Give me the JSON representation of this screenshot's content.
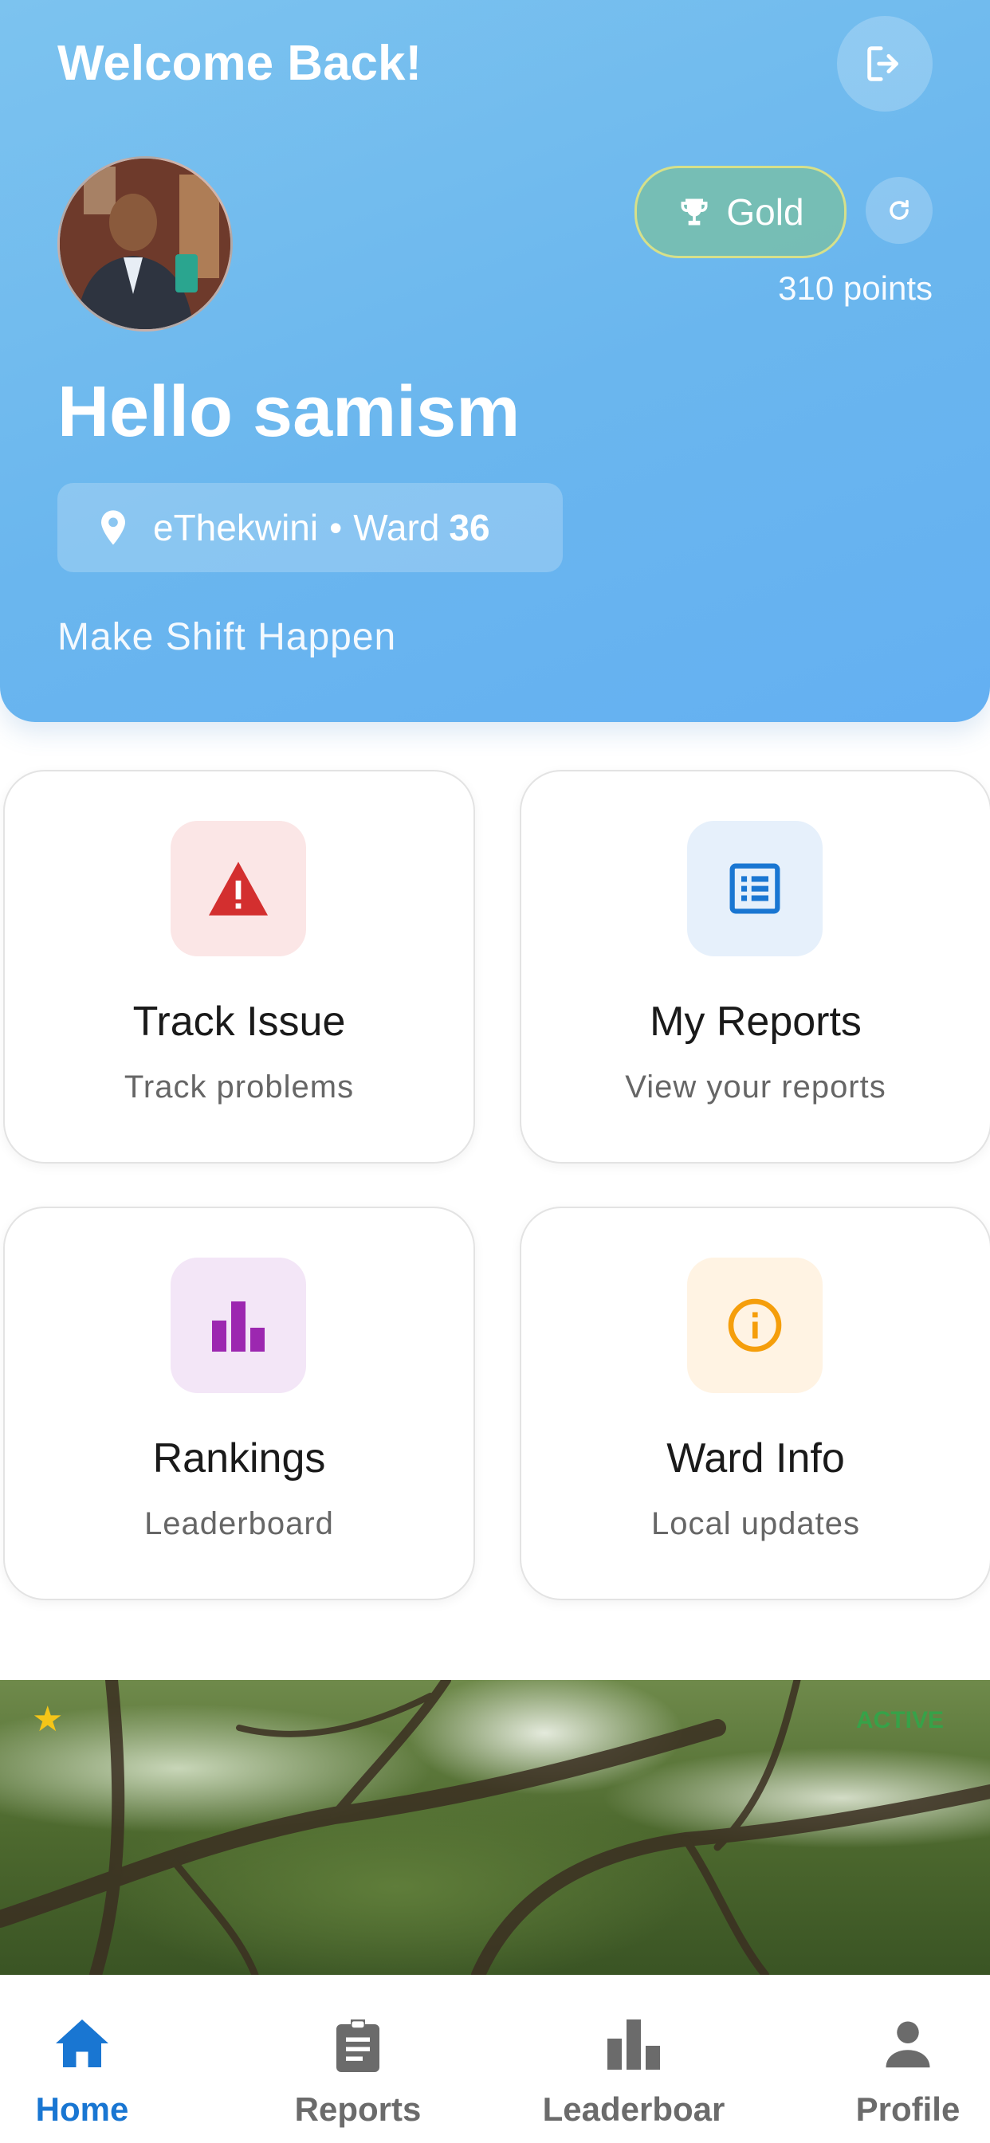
{
  "header": {
    "welcome": "Welcome Back!",
    "badge_label": "Gold",
    "points": "310 points",
    "greeting": "Hello samism",
    "city": "eThekwini",
    "separator": "•",
    "ward_label": "Ward",
    "ward_number": "36",
    "tagline": "Make Shift Happen"
  },
  "cards": [
    {
      "title": "Track Issue",
      "subtitle": "Track problems",
      "icon": "warning-icon",
      "color": "#d32f2f",
      "bg": "#fbe6e6"
    },
    {
      "title": "My Reports",
      "subtitle": "View your reports",
      "icon": "list-icon",
      "color": "#1976d2",
      "bg": "#e6f0fb"
    },
    {
      "title": "Rankings",
      "subtitle": "Leaderboard",
      "icon": "bar-chart-icon",
      "color": "#9c27b0",
      "bg": "#f3e6f7"
    },
    {
      "title": "Ward Info",
      "subtitle": "Local updates",
      "icon": "info-icon",
      "color": "#f59e0b",
      "bg": "#fff3e3"
    }
  ],
  "banner": {
    "status": "ACTIVE"
  },
  "nav": {
    "items": [
      {
        "label": "Home",
        "icon": "home-icon",
        "active": true
      },
      {
        "label": "Reports",
        "icon": "clipboard-icon",
        "active": false
      },
      {
        "label": "Leaderboar",
        "icon": "leaderboard-icon",
        "active": false
      },
      {
        "label": "Profile",
        "icon": "person-icon",
        "active": false
      }
    ],
    "active_color": "#1976d2",
    "inactive_color": "#6b6b6b"
  }
}
